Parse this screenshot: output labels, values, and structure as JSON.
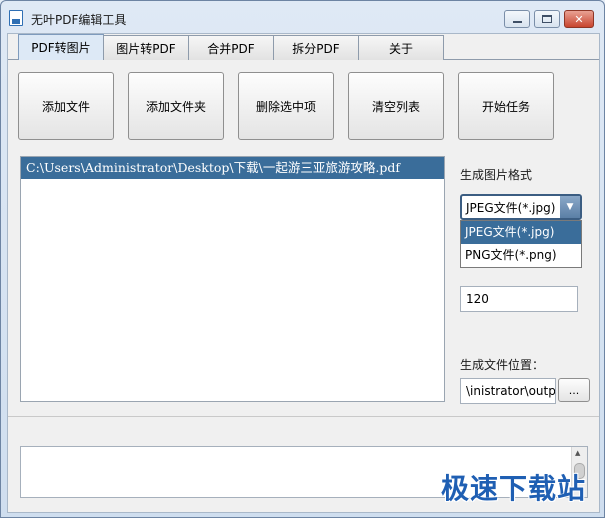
{
  "window": {
    "title": "无叶PDF编辑工具",
    "minimize_icon": "minimize-icon",
    "maximize_icon": "maximize-icon",
    "close_label": "✕"
  },
  "tabs": [
    {
      "label": "PDF转图片",
      "active": true
    },
    {
      "label": "图片转PDF"
    },
    {
      "label": "合并PDF"
    },
    {
      "label": "拆分PDF"
    },
    {
      "label": "关于"
    }
  ],
  "toolbar": {
    "add_file": "添加文件",
    "add_folder": "添加文件夹",
    "delete_selected": "删除选中项",
    "clear_list": "清空列表",
    "start_task": "开始任务"
  },
  "file_list": {
    "items": [
      "C:\\Users\\Administrator\\Desktop\\下载\\一起游三亚旅游攻略.pdf"
    ]
  },
  "options": {
    "format_label": "生成图片格式",
    "format_selected": "JPEG文件(*.jpg)",
    "format_options": [
      "JPEG文件(*.jpg)",
      "PNG文件(*.png)"
    ],
    "dpi_value": "120",
    "output_label": "生成文件位置：",
    "output_value": "\\inistrator\\output",
    "browse_label": "..."
  },
  "watermark": "极速下载站",
  "colors": {
    "selection": "#3a6d9a",
    "accent": "#1f5fb3"
  }
}
